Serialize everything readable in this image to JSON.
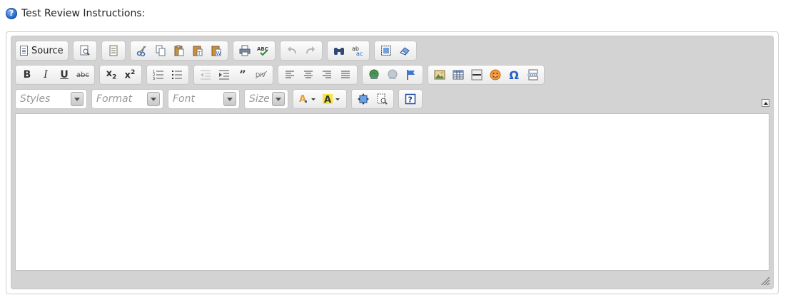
{
  "label": {
    "text": "Test Review Instructions:",
    "help_icon": "question-circle-icon",
    "accent": "#1d5fc5"
  },
  "toolbar": {
    "source_label": "Source",
    "combos": {
      "styles": "Styles",
      "format": "Format",
      "font": "Font",
      "size": "Size"
    }
  },
  "editor": {
    "content": ""
  }
}
